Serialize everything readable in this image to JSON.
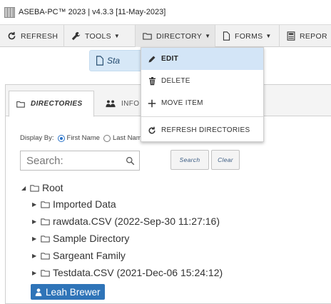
{
  "window": {
    "title": "ASEBA-PC™ 2023 | v4.3.3  [11-May-2023]"
  },
  "toolbar": {
    "refresh_label": "REFRESH",
    "tools_label": "TOOLS",
    "directory_label": "DIRECTORY",
    "forms_label": "FORMS",
    "reports_label": "REPOR"
  },
  "start_button": {
    "label": "Sta"
  },
  "directory_menu": {
    "items": [
      {
        "label": "EDIT",
        "icon": "pencil-icon"
      },
      {
        "label": "DELETE",
        "icon": "trash-icon"
      },
      {
        "label": "MOVE ITEM",
        "icon": "plus-icon"
      },
      {
        "label": "REFRESH DIRECTORIES",
        "icon": "refresh-icon"
      }
    ],
    "highlighted": "EDIT"
  },
  "tabs": {
    "directories_label": "DIRECTORIES",
    "info_label": "INFO"
  },
  "display_by": {
    "label": "Display By:",
    "option_first": "First Name",
    "option_last": "Last Name",
    "selected": "First Name"
  },
  "search": {
    "placeholder": "Search:",
    "search_button": "Search",
    "clear_button": "Clear"
  },
  "tree": {
    "root": "Root",
    "children": [
      "Imported Data",
      "rawdata.CSV (2022-Sep-30 11:27:16)",
      "Sample Directory",
      "Sargeant Family",
      "Testdata.CSV (2021-Dec-06 15:24:12)"
    ],
    "selected_person": "Leah Brewer"
  },
  "colors": {
    "accent": "#2f74b8",
    "menu_highlight": "#d3e5f7",
    "start_button_bg": "#d7e8f7"
  }
}
